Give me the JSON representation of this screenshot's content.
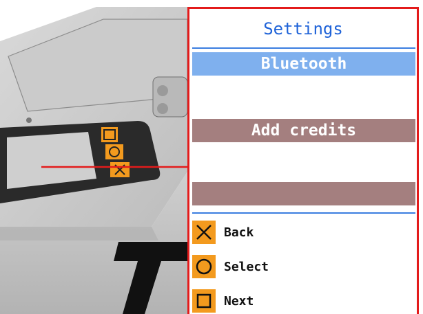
{
  "screen": {
    "title": "Settings",
    "menu": [
      {
        "label": "Bluetooth",
        "state": "selected"
      },
      {
        "label": "",
        "state": "empty"
      },
      {
        "label": "Add credits",
        "state": "normal"
      },
      {
        "label": "",
        "state": "empty"
      },
      {
        "label": "",
        "state": "normal"
      }
    ],
    "legend": [
      {
        "label": "Back",
        "icon": "cross-icon"
      },
      {
        "label": "Select",
        "icon": "circle-icon"
      },
      {
        "label": "Next",
        "icon": "square-icon"
      }
    ]
  },
  "colors": {
    "frame": "#e31b1b",
    "title": "#1f63d8",
    "selected": "#7fb0ee",
    "normal": "#a47f7f",
    "button": "#f39a1e"
  }
}
